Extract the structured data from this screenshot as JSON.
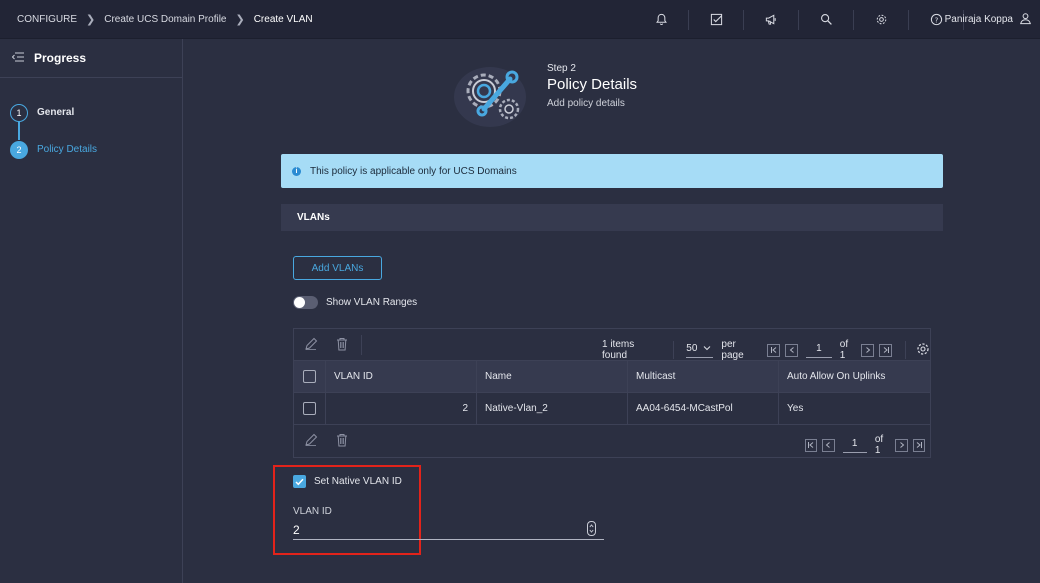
{
  "topbar": {
    "breadcrumbs": [
      "CONFIGURE",
      "Create UCS Domain Profile",
      "Create VLAN"
    ],
    "user_name": "Paniraja Koppa",
    "icons": [
      "bell-icon",
      "checklist-icon",
      "megaphone-icon",
      "search-icon",
      "gear-icon",
      "help-icon",
      "user-icon"
    ]
  },
  "sidebar": {
    "title": "Progress",
    "steps": [
      {
        "number": "1",
        "label": "General",
        "state": "done"
      },
      {
        "number": "2",
        "label": "Policy Details",
        "state": "active"
      }
    ]
  },
  "main": {
    "step_label": "Step 2",
    "step_title": "Policy Details",
    "step_desc": "Add policy details",
    "info_text": "This policy is applicable only for UCS Domains",
    "section_title": "VLANs",
    "add_button": "Add VLANs",
    "toggle_label": "Show VLAN Ranges",
    "table": {
      "items_found": "1 items found",
      "per_page_value": "50",
      "per_page_label": "per page",
      "page": "1",
      "of_pages": "of 1",
      "columns": [
        "VLAN ID",
        "Name",
        "Multicast",
        "Auto Allow On Uplinks"
      ],
      "rows": [
        {
          "vlan_id": "2",
          "name": "Native-Vlan_2",
          "multicast": "AA04-6454-MCastPol",
          "auto_allow": "Yes"
        }
      ]
    },
    "native": {
      "checkbox_label": "Set Native VLAN ID",
      "field_label": "VLAN ID",
      "field_value": "2"
    }
  },
  "colors": {
    "accent": "#49a8e0",
    "info_bg": "#a6dcf6",
    "highlight": "#e2231a"
  }
}
